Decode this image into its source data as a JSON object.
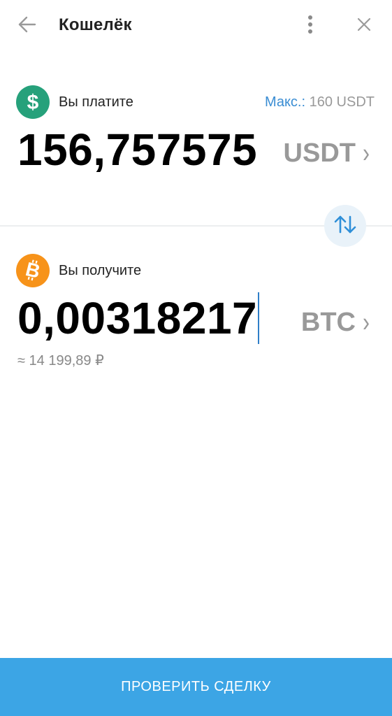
{
  "header": {
    "title": "Кошелёк",
    "icons": {
      "back": "arrow-left-icon",
      "menu": "more-vertical-icon",
      "close": "close-icon"
    }
  },
  "pay": {
    "label": "Вы платите",
    "max_label": "Макс.:",
    "max_value": "160 USDT",
    "amount": "156,757575",
    "currency": "USDT",
    "chevron": "›",
    "icon": "dollar-icon",
    "icon_color": "#26a17b"
  },
  "swap": {
    "icon": "swap-vertical-icon"
  },
  "receive": {
    "label": "Вы получите",
    "amount": "0,00318217",
    "currency": "BTC",
    "chevron": "›",
    "approx": "≈ 14 199,89 ₽",
    "icon": "bitcoin-icon",
    "icon_color": "#f7931a"
  },
  "action": {
    "label": "ПРОВЕРИТЬ СДЕЛКУ",
    "color": "#3ca5e5"
  },
  "colors": {
    "accent": "#3a8dd3",
    "muted": "#999999"
  }
}
